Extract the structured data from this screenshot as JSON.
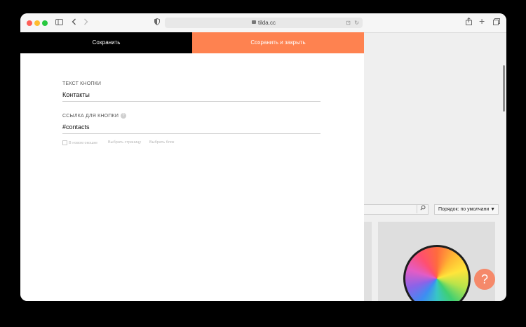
{
  "browser": {
    "url": "tilda.cc",
    "icons": {
      "sidebar": "sidebar-icon",
      "back": "chevron-left-icon",
      "forward": "chevron-right-icon",
      "shield": "shield-icon",
      "share": "share-icon",
      "new_tab": "plus-icon",
      "tabs": "tabs-icon"
    }
  },
  "editor": {
    "save_label": "Сохранить",
    "save_close_label": "Сохранить и закрыть",
    "button_text_label": "ТЕКСТ КНОПКИ",
    "button_text_value": "Контакты",
    "button_link_label": "ССЫЛКА ДЛЯ КНОПКИ",
    "button_link_value": "#contacts",
    "options": {
      "new_window": "В новом окошке",
      "choose_page": "Выбрать страницу",
      "choose_block": "Выбрать блок"
    },
    "accent_color": "#fe8250"
  },
  "background_page": {
    "sort_label": "Порядок: по умолчани",
    "help_label": "?"
  }
}
